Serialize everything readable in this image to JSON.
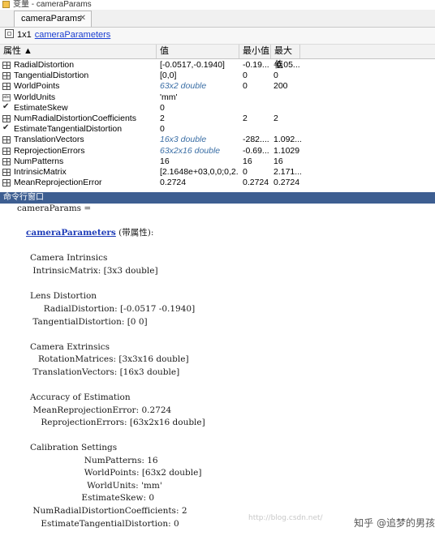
{
  "window": {
    "title": "变量 - cameraParams"
  },
  "tab": {
    "label": "cameraParams",
    "close_glyph": "✕"
  },
  "info": {
    "size": "1x1",
    "class_link": "cameraParameters"
  },
  "table": {
    "headers": [
      "属性 ▲",
      "值",
      "最小值",
      "最大值"
    ],
    "rows": [
      {
        "icon": "grid-icon",
        "name": "RadialDistortion",
        "value": "[-0.0517,-0.1940]",
        "min": "-0.19...",
        "max": "-0.05...",
        "italic": false
      },
      {
        "icon": "grid-icon",
        "name": "TangentialDistortion",
        "value": "[0,0]",
        "min": "0",
        "max": "0",
        "italic": false
      },
      {
        "icon": "grid-icon",
        "name": "WorldPoints",
        "value": "63x2 double",
        "min": "0",
        "max": "200",
        "italic": true
      },
      {
        "icon": "abc-icon",
        "name": "WorldUnits",
        "value": "'mm'",
        "min": "",
        "max": "",
        "italic": false
      },
      {
        "icon": "check-icon",
        "name": "EstimateSkew",
        "value": "0",
        "min": "",
        "max": "",
        "italic": false
      },
      {
        "icon": "grid-icon",
        "name": "NumRadialDistortionCoefficients",
        "value": "2",
        "min": "2",
        "max": "2",
        "italic": false
      },
      {
        "icon": "check-icon",
        "name": "EstimateTangentialDistortion",
        "value": "0",
        "min": "",
        "max": "",
        "italic": false
      },
      {
        "icon": "grid-icon",
        "name": "TranslationVectors",
        "value": "16x3 double",
        "min": "-282....",
        "max": "1.092...",
        "italic": true
      },
      {
        "icon": "grid-icon",
        "name": "ReprojectionErrors",
        "value": "63x2x16 double",
        "min": "-0.69...",
        "max": "1.1029",
        "italic": true
      },
      {
        "icon": "grid-icon",
        "name": "NumPatterns",
        "value": "16",
        "min": "16",
        "max": "16",
        "italic": false
      },
      {
        "icon": "grid-icon",
        "name": "IntrinsicMatrix",
        "value": "[2.1648e+03,0,0;0,2...",
        "min": "0",
        "max": "2.171...",
        "italic": false
      },
      {
        "icon": "grid-icon",
        "name": "MeanReprojectionError",
        "value": "0.2724",
        "min": "0.2724",
        "max": "0.2724",
        "italic": false
      }
    ]
  },
  "command_window": {
    "header": "命令行窗口",
    "line_0": "cameraParams =",
    "link": "cameraParameters",
    "link_suffix": " (带属性):",
    "lines": [
      "Camera Intrinsics",
      " IntrinsicMatrix: [3x3 double]",
      "Lens Distortion",
      "     RadialDistortion: [-0.0517 -0.1940]",
      " TangentialDistortion: [0 0]",
      "Camera Extrinsics",
      "   RotationMatrices: [3x3x16 double]",
      " TranslationVectors: [16x3 double]",
      "Accuracy of Estimation",
      " MeanReprojectionError: 0.2724",
      "    ReprojectionErrors: [63x2x16 double]",
      "Calibration Settings",
      "                    NumPatterns: 16",
      "                    WorldPoints: [63x2 double]",
      "                     WorldUnits: 'mm'",
      "                   EstimateSkew: 0",
      " NumRadialDistortionCoefficients: 2",
      "    EstimateTangentialDistortion: 0"
    ]
  },
  "watermark": {
    "text": "知乎 @追梦的男孩",
    "faint": "http://blog.csdn.net/"
  }
}
